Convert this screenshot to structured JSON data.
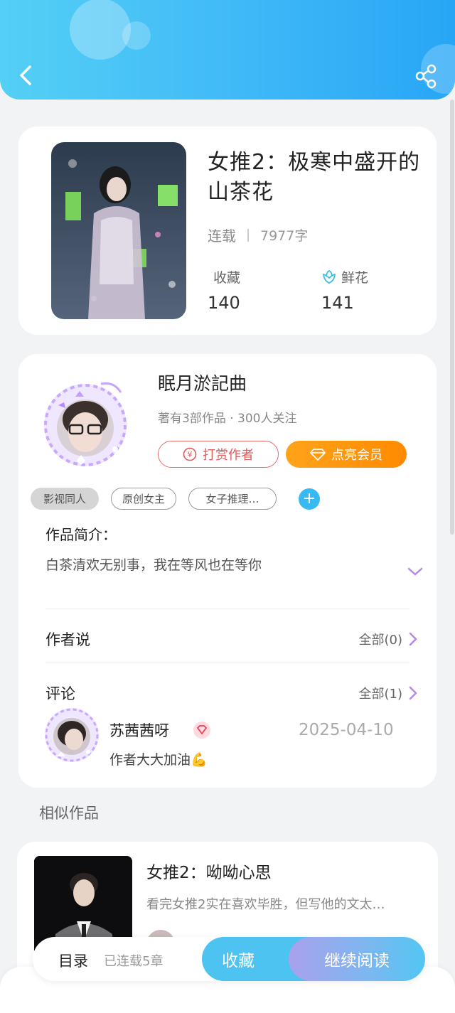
{
  "header": {
    "back_icon": "chevron-left-icon",
    "share_icon": "share-icon"
  },
  "book": {
    "title": "女推2：极寒中盛开的山茶花",
    "status": "连载",
    "word_count": "7977字",
    "favorites_label": "收藏",
    "favorites_count": "140",
    "flowers_label": "鲜花",
    "flowers_count": "141"
  },
  "author": {
    "name": "眠月淤記曲",
    "meta": "著有3部作品 · 300人关注",
    "reward_label": "打赏作者",
    "vip_label": "点亮会员",
    "tags": [
      "影视同人",
      "原创女主",
      "女子推理…"
    ],
    "intro_label": "作品简介：",
    "intro_text": "白茶清欢无别事，我在等风也在等你"
  },
  "author_says": {
    "label": "作者说",
    "link": "全部(0)"
  },
  "comments": {
    "label": "评论",
    "link": "全部(1)",
    "items": [
      {
        "user": "苏茜茜呀",
        "date": "2025-04-10",
        "text": "作者大大加油💪"
      }
    ]
  },
  "similar": {
    "label": "相似作品",
    "items": [
      {
        "title": "女推2：呦呦心思",
        "desc": "看完女推2实在喜欢毕胜，但写他的文太…"
      }
    ]
  },
  "bottom_bar": {
    "toc_label": "目录",
    "toc_sub": "已连载5章",
    "favorite_label": "收藏",
    "read_label": "继续阅读"
  },
  "colors": {
    "header": "#3fb8f7",
    "accent": "#38b9f1",
    "vip": "#ff9500",
    "reward": "#e25a5a"
  }
}
